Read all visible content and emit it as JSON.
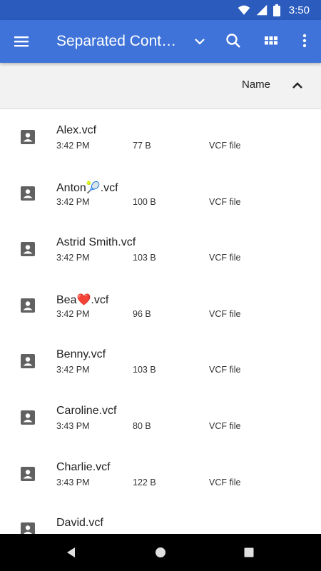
{
  "status_bar": {
    "time": "3:50",
    "icons": [
      "wifi-icon",
      "signal-icon",
      "battery-icon"
    ]
  },
  "app_bar": {
    "title": "Separated Contacts",
    "icons": [
      "menu-icon",
      "dropdown-arrow-icon",
      "search-icon",
      "grid-view-icon",
      "more-vert-icon"
    ]
  },
  "sort_header": {
    "label": "Name",
    "direction_icon": "chevron-up-icon"
  },
  "files": [
    {
      "name": "Alex.vcf",
      "time": "3:42 PM",
      "size": "77 B",
      "type": "VCF file"
    },
    {
      "name": "Anton🎾.vcf",
      "time": "3:42 PM",
      "size": "100 B",
      "type": "VCF file"
    },
    {
      "name": "Astrid Smith.vcf",
      "time": "3:42 PM",
      "size": "103 B",
      "type": "VCF file"
    },
    {
      "name": "Bea❤️.vcf",
      "time": "3:42 PM",
      "size": "96 B",
      "type": "VCF file"
    },
    {
      "name": "Benny.vcf",
      "time": "3:42 PM",
      "size": "103 B",
      "type": "VCF file"
    },
    {
      "name": "Caroline.vcf",
      "time": "3:43 PM",
      "size": "80 B",
      "type": "VCF file"
    },
    {
      "name": "Charlie.vcf",
      "time": "3:43 PM",
      "size": "122 B",
      "type": "VCF file"
    },
    {
      "name": "David.vcf",
      "time": "",
      "size": "",
      "type": ""
    }
  ],
  "colors": {
    "status_bar": "#2b5bbd",
    "app_bar": "#3f73d9",
    "sort_header": "#f2f2f2",
    "icon_gray": "#616161",
    "nav_bar": "#000000"
  },
  "nav_bar": {
    "icons": [
      "back-icon",
      "home-icon",
      "recents-icon"
    ]
  }
}
